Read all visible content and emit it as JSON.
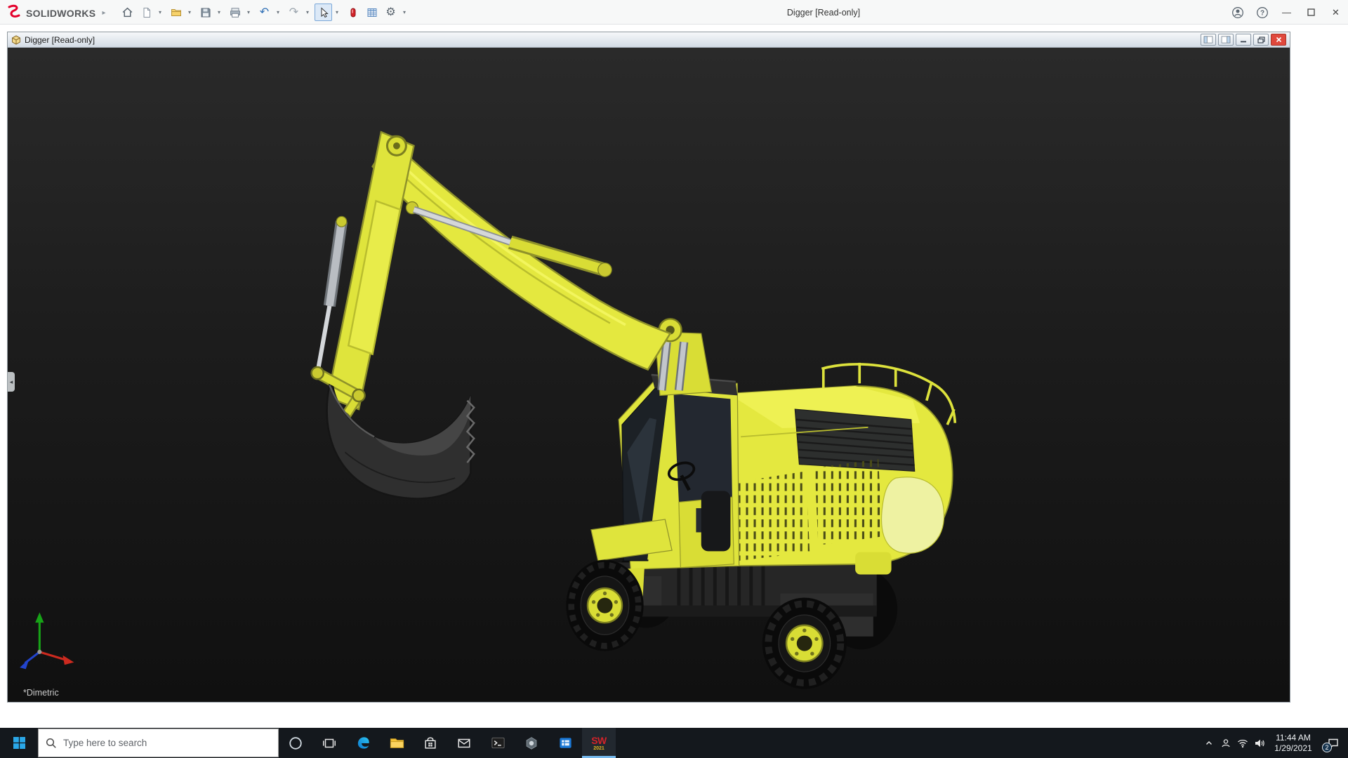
{
  "app": {
    "brand": "SOLIDWORKS",
    "window_title": "Digger [Read-only]",
    "toolbar_icons": [
      "home",
      "new-document",
      "open",
      "save",
      "print",
      "undo",
      "redo",
      "select",
      "appearances",
      "design-table",
      "options"
    ],
    "titlebar_controls": [
      "user-account",
      "help",
      "minimize",
      "maximize",
      "close"
    ]
  },
  "document_window": {
    "title": "Digger [Read-only]",
    "controls": [
      "split-pane-toggle",
      "full-pane-toggle",
      "minimize",
      "restore",
      "close"
    ],
    "view_label": "*Dimetric"
  },
  "taskbar": {
    "search": {
      "placeholder": "Type here to search"
    },
    "apps": [
      "start",
      "cortana",
      "task-view",
      "edge",
      "file-explorer",
      "store",
      "mail",
      "terminal",
      "hexagon-app",
      "blue-window-app",
      "solidworks"
    ],
    "solidworks_badge": {
      "label": "SW",
      "year": "2021"
    },
    "tray_icons": [
      "chevron-up",
      "person",
      "network",
      "volume",
      "action-center"
    ],
    "clock": {
      "time": "11:44 AM",
      "date": "1/29/2021"
    },
    "notification_count": "2"
  },
  "colors": {
    "excavator_yellow": "#e4e83f",
    "viewport_background": "#1a1a1a",
    "taskbar_background": "#14181d",
    "close_button_red": "#e0483c",
    "brand_red": "#e4002b",
    "windows_blue": "#2aa7e8"
  }
}
